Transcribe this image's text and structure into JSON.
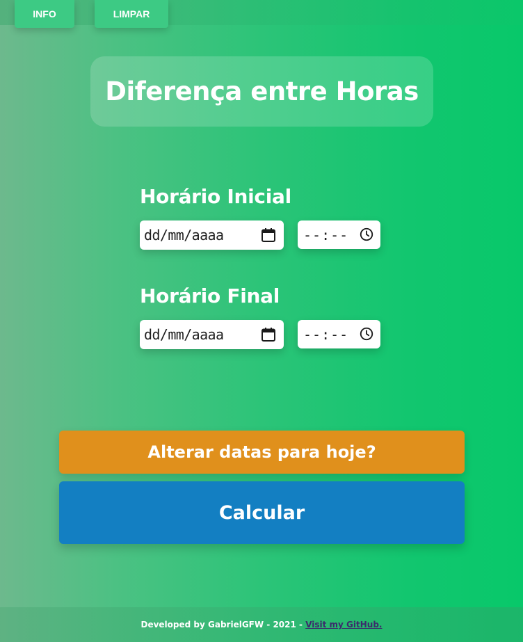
{
  "topbar": {
    "info_label": "INFO",
    "clear_label": "LIMPAR"
  },
  "title": "Diferença entre Horas",
  "initial": {
    "label": "Horário Inicial",
    "date_placeholder": "dd/mm/aaaa",
    "time_placeholder": "--:--",
    "date_icon": "calendar-icon",
    "time_icon": "clock-icon"
  },
  "final": {
    "label": "Horário Final",
    "date_placeholder": "dd/mm/aaaa",
    "time_placeholder": "--:--",
    "date_icon": "calendar-icon",
    "time_icon": "clock-icon"
  },
  "actions": {
    "today_label": "Alterar datas para hoje?",
    "calculate_label": "Calcular"
  },
  "footer": {
    "text": "Developed by GabrielGFW - 2021 - ",
    "link_text": "Visit my GitHub."
  },
  "colors": {
    "today_button": "#e0901c",
    "calculate_button": "#137fc2",
    "link": "#3b2c6b",
    "background_start": "#6db98d",
    "background_end": "#08c86a"
  }
}
